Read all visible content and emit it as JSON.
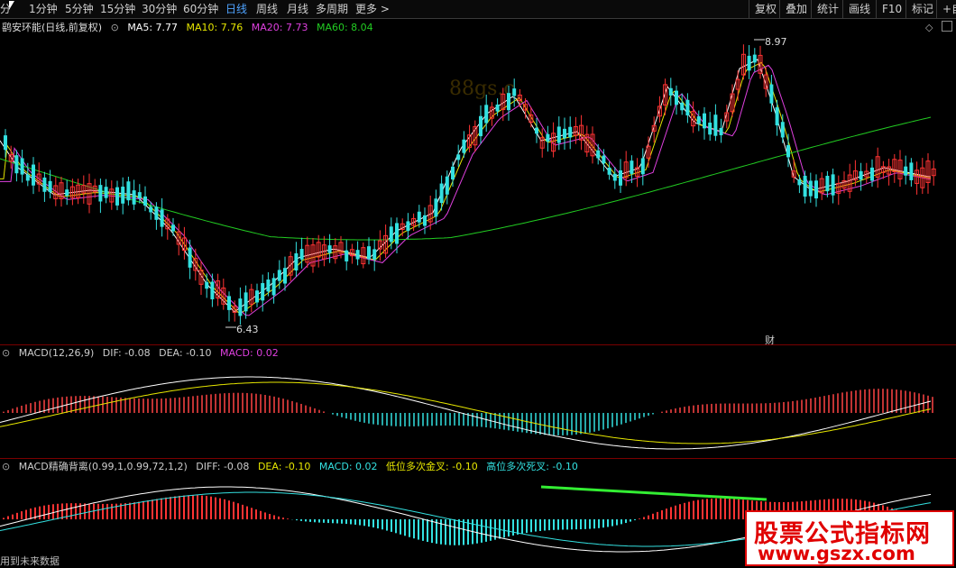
{
  "toolbar": {
    "cursor_icon": "cursor-arrow-icon",
    "periods": [
      "分",
      "1分钟",
      "5分钟",
      "15分钟",
      "30分钟",
      "60分钟",
      "日线",
      "周线",
      "月线",
      "多周期",
      "更多 >"
    ],
    "active_period": "日线",
    "right_buttons": [
      "复权",
      "叠加",
      "统计",
      "画线",
      "F10",
      "标记",
      "+自"
    ]
  },
  "main_chart": {
    "title": "鹞安环能(日线,前复权)",
    "ma5": "MA5: 7.77",
    "ma10": "MA10: 7.76",
    "ma20": "MA20: 7.73",
    "ma60": "MA60: 8.04",
    "high_label": "8.97",
    "low_label": "6.43",
    "fin_marker": "财",
    "watermark_text": "88gs.c",
    "colors": {
      "up": "#ff3333",
      "down": "#33e0e0",
      "ma5": "#ffffff",
      "ma10": "#e6e600",
      "ma20": "#e040e0",
      "ma60": "#22cc22"
    }
  },
  "macd_panel": {
    "title": "MACD(12,26,9)",
    "dif": "DIF: -0.08",
    "dea": "DEA: -0.10",
    "macd": "MACD: 0.02"
  },
  "divergence_panel": {
    "title": "MACD精确背离(0.99,1,0.99,72,1,2)",
    "diff": "DIFF: -0.08",
    "dea": "DEA: -0.10",
    "macd": "MACD: 0.02",
    "low_cross": "低位多次金叉: -0.10",
    "high_cross": "高位多次死叉: -0.10"
  },
  "footer": {
    "text": "用到未来数据"
  },
  "brand": {
    "title": "股票公式指标网",
    "url": "www.gszx.com"
  }
}
